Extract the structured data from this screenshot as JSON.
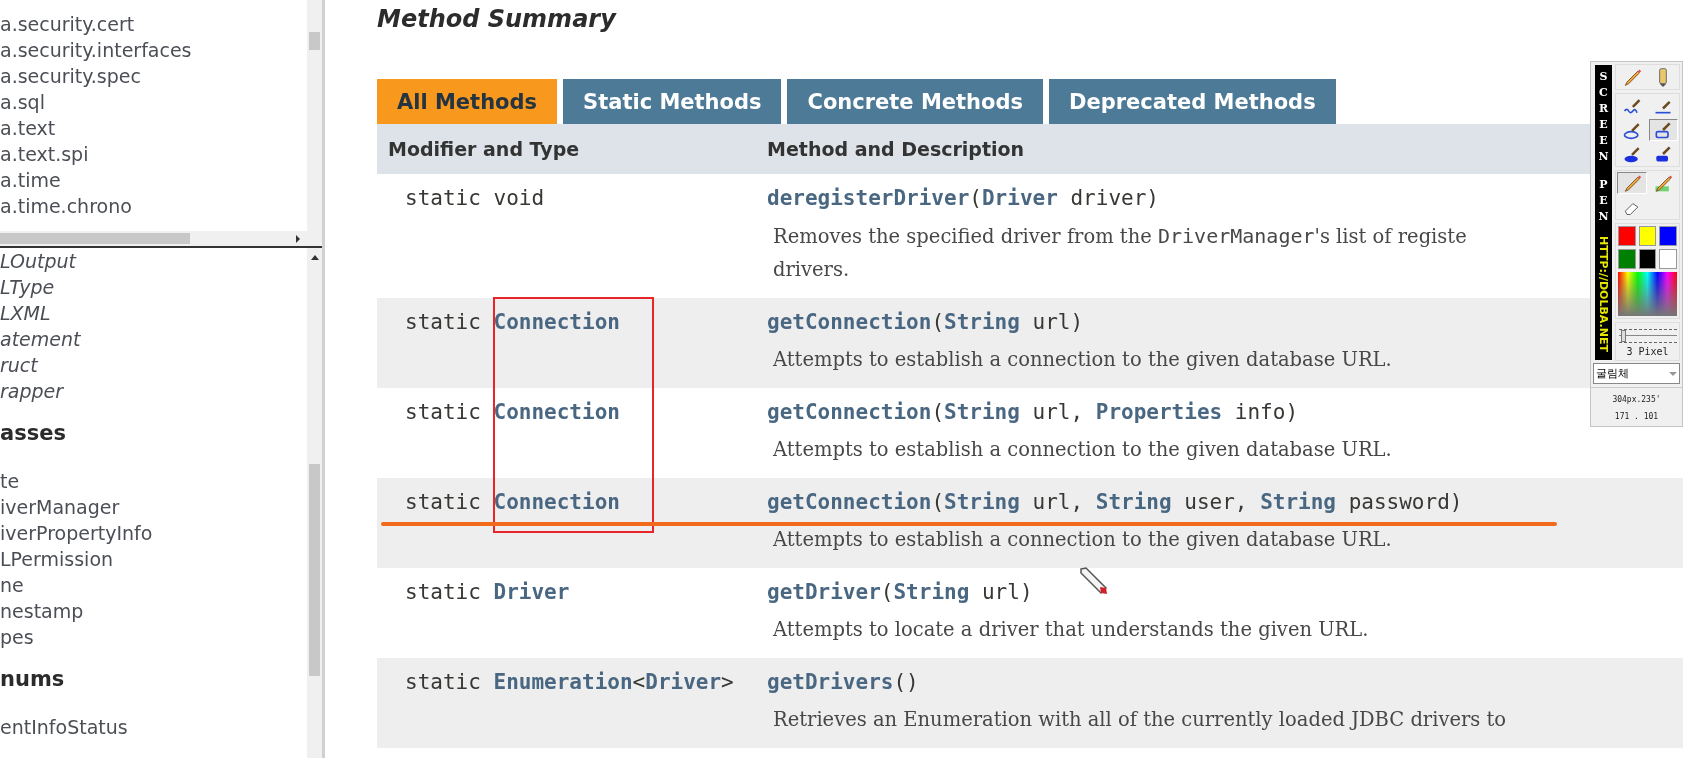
{
  "sidebar": {
    "packages": [
      "a.security.cert",
      "a.security.interfaces",
      "a.security.spec",
      "a.sql",
      "a.text",
      "a.text.spi",
      "a.time",
      "a.time.chrono"
    ],
    "class_groups": [
      {
        "kind": "interface",
        "items": [
          "LOutput",
          "LType",
          "LXML",
          "atement",
          "ruct",
          "rapper"
        ]
      },
      {
        "kind": "class",
        "heading": "asses",
        "items": [
          "te",
          "iverManager",
          "iverPropertyInfo",
          "LPermission",
          "ne",
          "nestamp",
          "pes"
        ]
      },
      {
        "kind": "class",
        "heading": "nums",
        "items": [
          "entInfoStatus"
        ]
      }
    ]
  },
  "summary": {
    "title": "Method Summary",
    "tabs": [
      {
        "label": "All Methods",
        "selected": true
      },
      {
        "label": "Static Methods",
        "selected": false
      },
      {
        "label": "Concrete Methods",
        "selected": false
      },
      {
        "label": "Deprecated Methods",
        "selected": false
      }
    ],
    "columns": [
      "Modifier and Type",
      "Method and Description"
    ],
    "rows": [
      {
        "type": [
          {
            "text": "static void",
            "link": false
          }
        ],
        "signature": [
          {
            "text": "deregisterDriver",
            "link": true
          },
          {
            "text": "(",
            "link": false
          },
          {
            "text": "Driver",
            "link": true
          },
          {
            "text": " driver)",
            "link": false
          }
        ],
        "description": [
          [
            {
              "text": "Removes the specified driver from the ",
              "code": false
            },
            {
              "text": "DriverManager",
              "code": true
            },
            {
              "text": "'s list of registe",
              "code": false
            }
          ],
          [
            {
              "text": "drivers.",
              "code": false
            }
          ]
        ]
      },
      {
        "type": [
          {
            "text": "static ",
            "link": false
          },
          {
            "text": "Connection",
            "link": true
          }
        ],
        "signature": [
          {
            "text": "getConnection",
            "link": true
          },
          {
            "text": "(",
            "link": false
          },
          {
            "text": "String",
            "link": true
          },
          {
            "text": " url)",
            "link": false
          }
        ],
        "description": [
          [
            {
              "text": "Attempts to establish a connection to the given database URL.",
              "code": false
            }
          ]
        ]
      },
      {
        "type": [
          {
            "text": "static ",
            "link": false
          },
          {
            "text": "Connection",
            "link": true
          }
        ],
        "signature": [
          {
            "text": "getConnection",
            "link": true
          },
          {
            "text": "(",
            "link": false
          },
          {
            "text": "String",
            "link": true
          },
          {
            "text": " url, ",
            "link": false
          },
          {
            "text": "Properties",
            "link": true
          },
          {
            "text": " info)",
            "link": false
          }
        ],
        "description": [
          [
            {
              "text": "Attempts to establish a connection to the given database URL.",
              "code": false
            }
          ]
        ]
      },
      {
        "type": [
          {
            "text": "static ",
            "link": false
          },
          {
            "text": "Connection",
            "link": true
          }
        ],
        "signature": [
          {
            "text": "getConnection",
            "link": true
          },
          {
            "text": "(",
            "link": false
          },
          {
            "text": "String",
            "link": true
          },
          {
            "text": " url, ",
            "link": false
          },
          {
            "text": "String",
            "link": true
          },
          {
            "text": " user, ",
            "link": false
          },
          {
            "text": "String",
            "link": true
          },
          {
            "text": " password)",
            "link": false
          }
        ],
        "description": [
          [
            {
              "text": "Attempts to establish a connection to the given database URL.",
              "code": false
            }
          ]
        ]
      },
      {
        "type": [
          {
            "text": "static ",
            "link": false
          },
          {
            "text": "Driver",
            "link": true
          }
        ],
        "signature": [
          {
            "text": "getDriver",
            "link": true
          },
          {
            "text": "(",
            "link": false
          },
          {
            "text": "String",
            "link": true
          },
          {
            "text": " url)",
            "link": false
          }
        ],
        "description": [
          [
            {
              "text": "Attempts to locate a driver that understands the given URL.",
              "code": false
            }
          ]
        ]
      },
      {
        "type": [
          {
            "text": "static ",
            "link": false
          },
          {
            "text": "Enumeration",
            "link": true
          },
          {
            "text": "<",
            "link": false
          },
          {
            "text": "Driver",
            "link": true
          },
          {
            "text": ">",
            "link": false
          }
        ],
        "signature": [
          {
            "text": "getDrivers",
            "link": true
          },
          {
            "text": "()",
            "link": false
          }
        ],
        "description": [
          [
            {
              "text": "Retrieves an Enumeration with all of the currently loaded JDBC drivers to",
              "code": false
            }
          ]
        ]
      }
    ]
  },
  "annotations": [
    {
      "kind": "box",
      "color": "#e8262a"
    },
    {
      "kind": "underline",
      "color": "#f26a1b"
    },
    {
      "kind": "pen-cursor"
    }
  ],
  "screen_pen": {
    "brand": [
      "SCREEN",
      "PEN"
    ],
    "url": "HTTP://DOLBA.NET",
    "tool_groups": [
      [
        {
          "kind": "pencil",
          "selected": false
        },
        {
          "kind": "text-pen",
          "selected": false
        }
      ],
      [
        {
          "kind": "freehand",
          "selected": false
        },
        {
          "kind": "line",
          "selected": false
        },
        {
          "kind": "ellipse",
          "selected": false
        },
        {
          "kind": "rectangle",
          "selected": true
        },
        {
          "kind": "filled-ellipse",
          "selected": false
        },
        {
          "kind": "filled-rectangle",
          "selected": false
        }
      ],
      [
        {
          "kind": "pencil",
          "selected": true
        },
        {
          "kind": "highlighter",
          "selected": false
        },
        {
          "kind": "eraser",
          "selected": false
        }
      ]
    ],
    "colors": [
      {
        "color": "#ff0000"
      },
      {
        "color": "#ffff00"
      },
      {
        "color": "#0000ff"
      },
      {
        "color": "#008000"
      },
      {
        "color": "#000000"
      },
      {
        "color": "#ffffff"
      }
    ],
    "thickness": {
      "level": 0.08,
      "reading": "3 Pixel"
    },
    "font": {
      "value": "굴림체"
    },
    "readouts": [
      "304px.235'",
      "171 . 101"
    ]
  }
}
